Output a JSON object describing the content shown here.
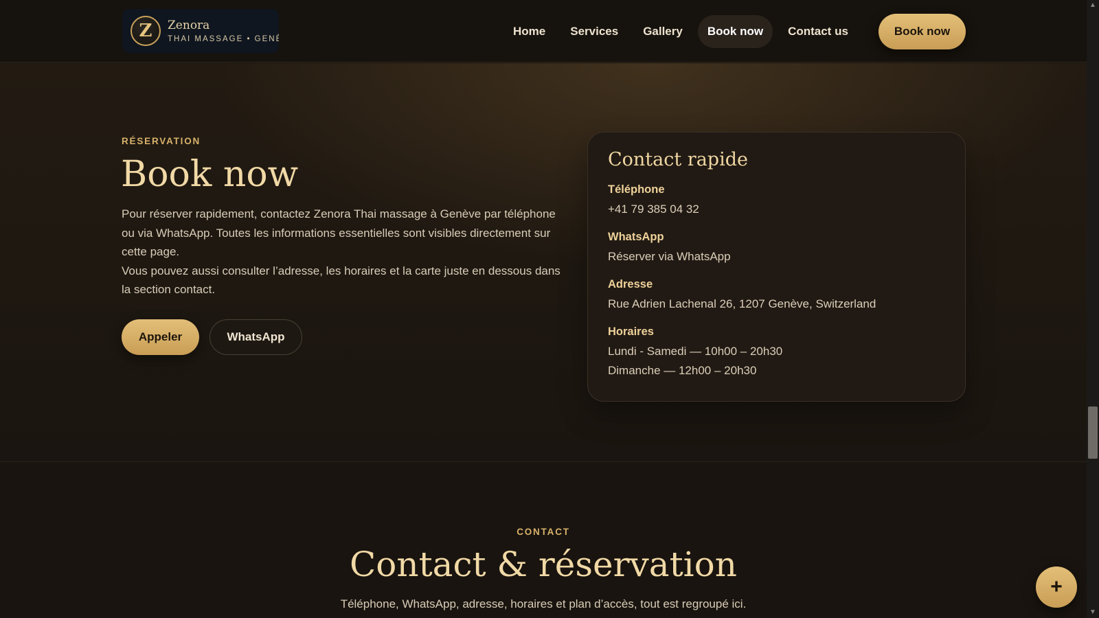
{
  "header": {
    "logo": {
      "letter": "Z",
      "name": "Zenora",
      "tagline": "THAI MASSAGE • GENÈ"
    },
    "nav": [
      {
        "label": "Home"
      },
      {
        "label": "Services"
      },
      {
        "label": "Gallery"
      },
      {
        "label": "Book now",
        "active": true
      },
      {
        "label": "Contact us"
      }
    ],
    "cta_label": "Book now"
  },
  "booking": {
    "eyebrow": "RÉSERVATION",
    "title": "Book now",
    "paragraph1": "Pour réserver rapidement, contactez Zenora Thai massage à Genève par téléphone ou via WhatsApp. Toutes les informations essentielles sont visibles directement sur cette page.",
    "paragraph2": "Vous pouvez aussi consulter l’adresse, les horaires et la carte juste en dessous dans la section contact.",
    "call_label": "Appeler",
    "whatsapp_label": "WhatsApp"
  },
  "quick_contact": {
    "title": "Contact rapide",
    "phone": {
      "label": "Téléphone",
      "value": "+41 79 385 04 32"
    },
    "whatsapp": {
      "label": "WhatsApp",
      "value": "Réserver via WhatsApp"
    },
    "address": {
      "label": "Adresse",
      "value": "Rue Adrien Lachenal 26, 1207 Genève, Switzerland"
    },
    "hours": {
      "label": "Horaires",
      "lines": [
        "Lundi - Samedi — 10h00 – 20h30",
        "Dimanche — 12h00 – 20h30"
      ]
    }
  },
  "contact_section": {
    "eyebrow": "CONTACT",
    "title": "Contact & réservation",
    "subtitle": "Téléphone, WhatsApp, adresse, horaires et plan d’accès, tout est regroupé ici."
  },
  "fab": {
    "icon": "plus-icon",
    "glyph": "+"
  },
  "colors": {
    "accent_gold": "#d8b26b",
    "heading_gold": "#f1d9a6",
    "background": "#19140f"
  }
}
